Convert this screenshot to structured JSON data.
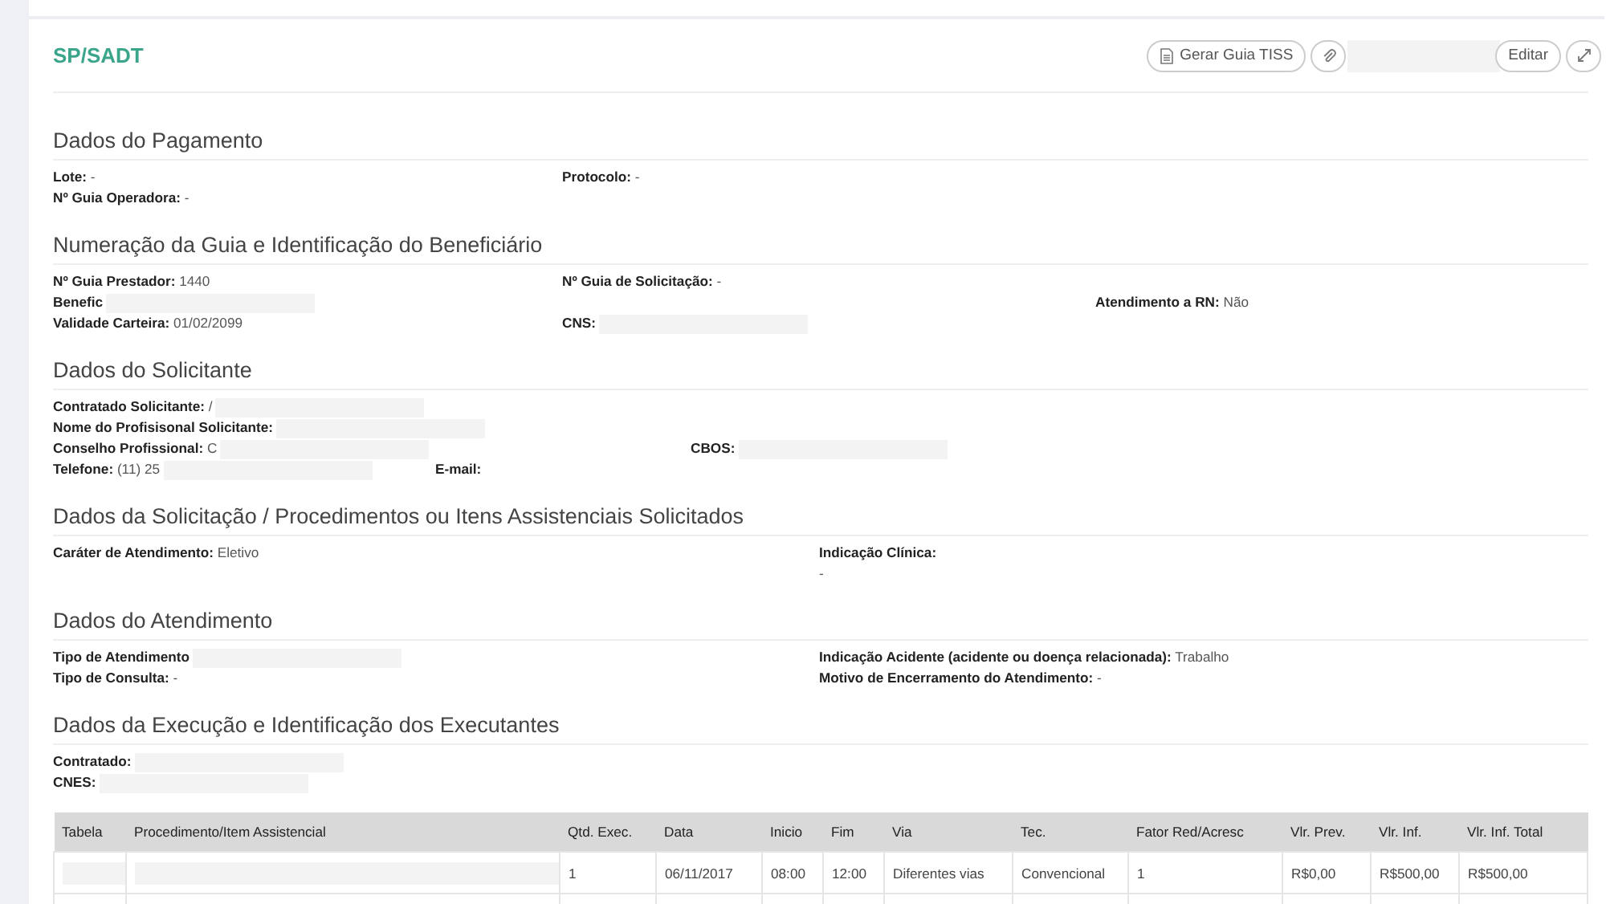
{
  "header": {
    "title": "SP/SADT",
    "buttons": [
      {
        "kind": "document",
        "label": "Gerar Guia TISS"
      },
      {
        "kind": "attach"
      },
      {
        "kind": "text",
        "label": "Editar"
      },
      {
        "kind": "expand"
      }
    ]
  },
  "sections": [
    {
      "title": "Dados do Pagamento",
      "fields": [
        {
          "kind": "inline",
          "text": "**Lote:** -",
          "redacted": false
        },
        {
          "kind": "inline",
          "text": "**Nº Guia Operadora:** -",
          "redacted": false
        },
        {
          "kind": "inline",
          "text": "**Protocolo:** -",
          "redacted": false
        }
      ]
    },
    {
      "title": "Numeração da Guia e Identificação do Beneficiário",
      "fields": [
        {
          "kind": "inline",
          "text": "**Nº Guia Prestador:** 1440",
          "redacted": false
        },
        {
          "kind": "inline",
          "text": "**Benefic**",
          "redacted": true
        },
        {
          "kind": "inline",
          "text": "**Validade Carteira:** 01/02/2099",
          "redacted": false
        },
        {
          "kind": "inline",
          "text": "**Nº Guia de Solicitação:** -",
          "redacted": false
        },
        {
          "kind": "inline",
          "text": "**CNS:**",
          "redacted": true
        },
        {
          "kind": "inline",
          "text": "**Atendimento a RN:** Não",
          "redacted": false
        }
      ]
    },
    {
      "title": "Dados do Solicitante",
      "fields": [
        {
          "kind": "inline",
          "text": "**Contratado Solicitante:** /",
          "redacted": true
        },
        {
          "kind": "inline",
          "text": "**Nome do Profisisonal Solicitante:**",
          "redacted": true
        },
        {
          "kind": "inline",
          "text": "**Conselho Profissional:** C",
          "redacted": true
        },
        {
          "kind": "inline",
          "text": "**Telefone:** (11) 25",
          "redacted": true
        },
        {
          "kind": "inline",
          "text": "**CBOS:**",
          "redacted": true
        },
        {
          "kind": "inline",
          "text": "**E-mail:**",
          "redacted": false
        }
      ]
    },
    {
      "title": "Dados da Solicitação / Procedimentos ou Itens Assistenciais Solicitados",
      "fields": [
        {
          "kind": "inline",
          "text": "**Caráter de Atendimento:** Eletivo",
          "redacted": false
        },
        {
          "kind": "stacked",
          "text": "**Indicação Clínica:**",
          "value": "-",
          "redacted": false
        }
      ]
    },
    {
      "title": "Dados do Atendimento",
      "fields": [
        {
          "kind": "inline",
          "text": "**Tipo de Atendimento**",
          "redacted": true
        },
        {
          "kind": "inline",
          "text": "**Tipo de Consulta:** -",
          "redacted": false
        },
        {
          "kind": "inline",
          "text": "**Indicação Acidente (acidente ou doença relacionada):** Trabalho",
          "redacted": false
        },
        {
          "kind": "inline",
          "text": "**Motivo de Encerramento do Atendimento:** -",
          "redacted": false
        }
      ]
    },
    {
      "title": "Dados da Execução e Identificação dos Executantes",
      "fields": [
        {
          "kind": "inline",
          "text": "**Contratado:**",
          "redacted": true
        },
        {
          "kind": "inline",
          "text": "**CNES:**",
          "redacted": true
        }
      ]
    }
  ],
  "table": {
    "columns": [
      "Tabela",
      "Procedimento/Item Assistencial",
      "Qtd. Exec.",
      "Data",
      "Inicio",
      "Fim",
      "Via",
      "Tec.",
      "Fator Red/Acresc",
      "Vlr. Prev.",
      "Vlr. Inf.",
      "Vlr. Inf. Total"
    ],
    "rows": [
      {
        "redacted": true,
        "cells": [
          "",
          "",
          "1",
          "06/11/2017",
          "08:00",
          "12:00",
          "Diferentes vias",
          "Convencional",
          "1",
          "R$0,00",
          "R$500,00",
          "R$500,00"
        ]
      }
    ]
  }
}
